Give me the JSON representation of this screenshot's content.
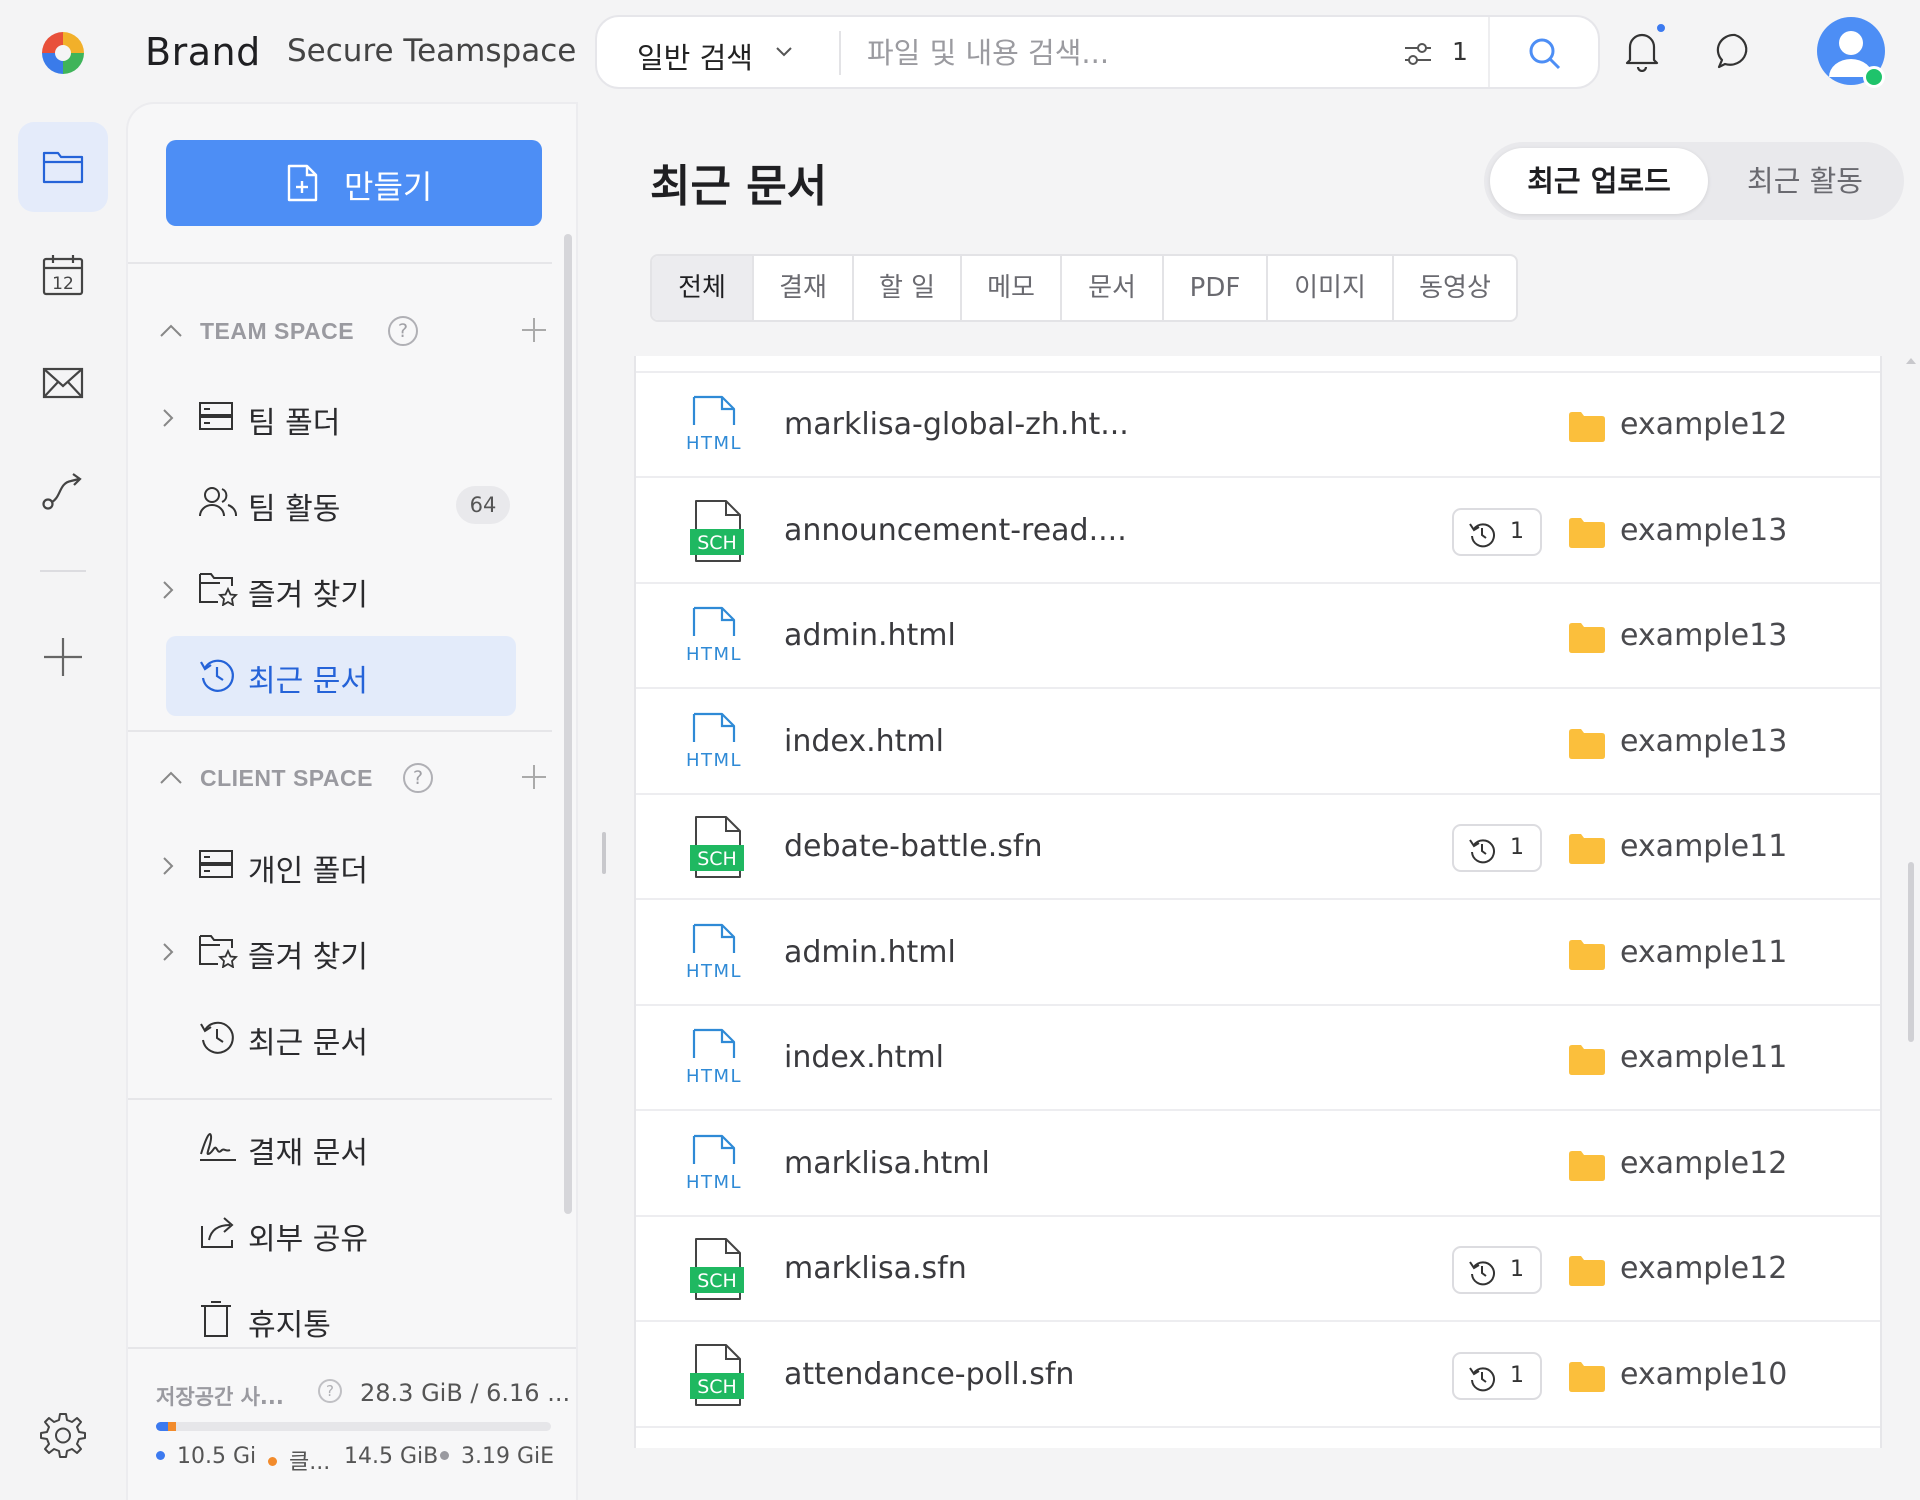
{
  "header": {
    "brand": "Brand",
    "workspace": "Secure Teamspace",
    "search_type": "일반 검색",
    "search_placeholder": "파일 및 내용 검색...",
    "filter_count": "1"
  },
  "rail": {
    "items": [
      "folder-icon",
      "calendar-icon",
      "mail-icon",
      "workflow-icon",
      "plus-icon"
    ],
    "calendar_day": "12"
  },
  "sidebar": {
    "create_label": "만들기",
    "team_space": {
      "title": "TEAM SPACE",
      "help": "?",
      "items": [
        {
          "label": "팀 폴더",
          "icon": "server-icon"
        },
        {
          "label": "팀 활동",
          "icon": "users-icon",
          "badge": "64"
        },
        {
          "label": "즐겨 찾기",
          "icon": "star-folder-icon"
        },
        {
          "label": "최근 문서",
          "icon": "history-icon",
          "active": true
        }
      ]
    },
    "client_space": {
      "title": "CLIENT SPACE",
      "help": "?",
      "items": [
        {
          "label": "개인 폴더",
          "icon": "server-icon"
        },
        {
          "label": "즐겨 찾기",
          "icon": "star-folder-icon"
        },
        {
          "label": "최근 문서",
          "icon": "history-icon"
        }
      ]
    },
    "extra": [
      {
        "label": "결재 문서",
        "icon": "signature-icon"
      },
      {
        "label": "외부 공유",
        "icon": "share-icon"
      },
      {
        "label": "휴지통",
        "icon": "trash-icon"
      }
    ],
    "storage": {
      "label": "저장공간 사...",
      "help": "?",
      "value": "28.3 GiB / 6.16 ...",
      "usage_fractions": [
        0.03,
        0.02
      ],
      "legend": [
        {
          "text": "10.5 Gi",
          "color": "#3c7af0"
        },
        {
          "text": "클...",
          "color": "#f28b2c"
        },
        {
          "text": "14.5 GiB",
          "color": null
        },
        {
          "text": "3.19 GiE",
          "color": "#9a9aa0"
        }
      ]
    }
  },
  "main": {
    "title": "최근 문서",
    "segment": {
      "on": "최근 업로드",
      "off": "최근 활동"
    },
    "tabs": [
      "전체",
      "결재",
      "할 일",
      "메모",
      "문서",
      "PDF",
      "이미지",
      "동영상"
    ],
    "rows": [
      {
        "type": "HTML",
        "name": "marklisa-global-zh.ht...",
        "folder": "example12",
        "versions": null
      },
      {
        "type": "SCH",
        "name": "announcement-read....",
        "folder": "example13",
        "versions": "1"
      },
      {
        "type": "HTML",
        "name": "admin.html",
        "folder": "example13",
        "versions": null
      },
      {
        "type": "HTML",
        "name": "index.html",
        "folder": "example13",
        "versions": null
      },
      {
        "type": "SCH",
        "name": "debate-battle.sfn",
        "folder": "example11",
        "versions": "1"
      },
      {
        "type": "HTML",
        "name": "admin.html",
        "folder": "example11",
        "versions": null
      },
      {
        "type": "HTML",
        "name": "index.html",
        "folder": "example11",
        "versions": null
      },
      {
        "type": "HTML",
        "name": "marklisa.html",
        "folder": "example12",
        "versions": null
      },
      {
        "type": "SCH",
        "name": "marklisa.sfn",
        "folder": "example12",
        "versions": "1"
      },
      {
        "type": "SCH",
        "name": "attendance-poll.sfn",
        "folder": "example10",
        "versions": "1"
      }
    ]
  },
  "colors": {
    "accent": "#4d8ef5",
    "folder": "#fbbf3c",
    "sch": "#1fb861",
    "html": "#2f8ad6"
  }
}
